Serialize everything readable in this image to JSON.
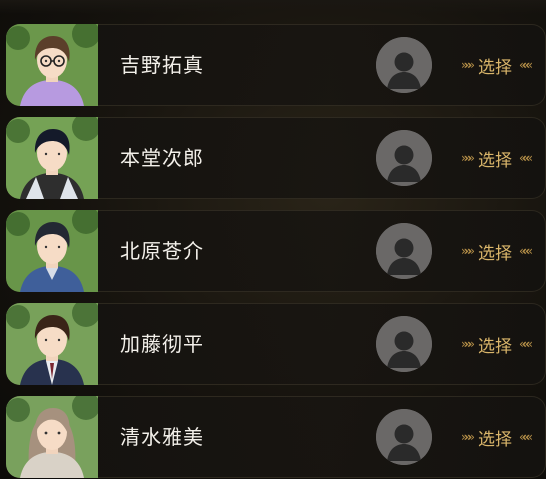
{
  "characters": [
    {
      "name": "吉野拓真",
      "select_label": "选择",
      "hair": "#5b3f2a",
      "shirt": "#b79ae0",
      "bg": "#5f8f3c",
      "glasses": true
    },
    {
      "name": "本堂次郎",
      "select_label": "选择",
      "hair": "#141a2a",
      "shirt": "#2e2e2e",
      "bg": "#6a9b47",
      "glasses": false
    },
    {
      "name": "北原苍介",
      "select_label": "选择",
      "hair": "#232833",
      "shirt": "#3f5f9a",
      "bg": "#5c8c3a",
      "glasses": false
    },
    {
      "name": "加藤彻平",
      "select_label": "选择",
      "hair": "#3a2418",
      "shirt": "#28324e",
      "bg": "#6d9a4c",
      "glasses": false
    },
    {
      "name": "清水雅美",
      "select_label": "选择",
      "hair": "#a6917e",
      "shirt": "#d9d2c7",
      "bg": "#6e9950",
      "glasses": false
    }
  ],
  "icons": {
    "chevrons_left": "»»»",
    "chevrons_right": "«««"
  },
  "colors": {
    "accent_gold": "#d9b56a",
    "chevron_gold": "#b58f48",
    "placeholder_avatar": "#6a6867"
  }
}
